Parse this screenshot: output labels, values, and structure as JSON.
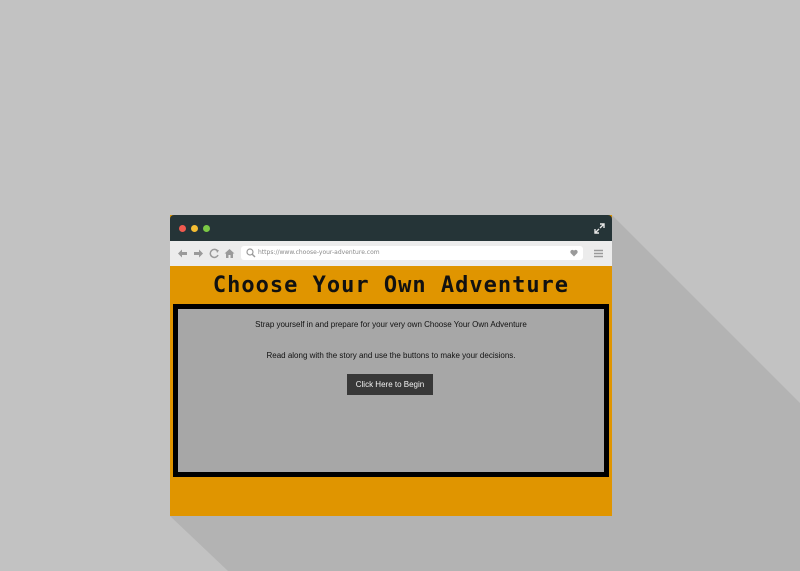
{
  "browser": {
    "url": "https://www.choose-your-adventure.com",
    "icons": [
      "close-dot",
      "minimize-dot",
      "zoom-dot",
      "expand-icon",
      "back-arrow-icon",
      "forward-arrow-icon",
      "reload-icon",
      "home-icon",
      "search-icon",
      "heart-icon",
      "menu-icon"
    ]
  },
  "page": {
    "title": "Choose Your Own Adventure",
    "intro_line": "Strap yourself in and prepare for your very own Choose Your Own Adventure",
    "instruction_line": "Read along with the story and use the buttons to make your decisions.",
    "begin_button_label": "Click Here to Begin"
  },
  "colors": {
    "background": "#c2c2c2",
    "titlebar": "#253437",
    "accent_orange": "#e09500",
    "content_panel": "#a7a7a7",
    "button": "#383838"
  }
}
